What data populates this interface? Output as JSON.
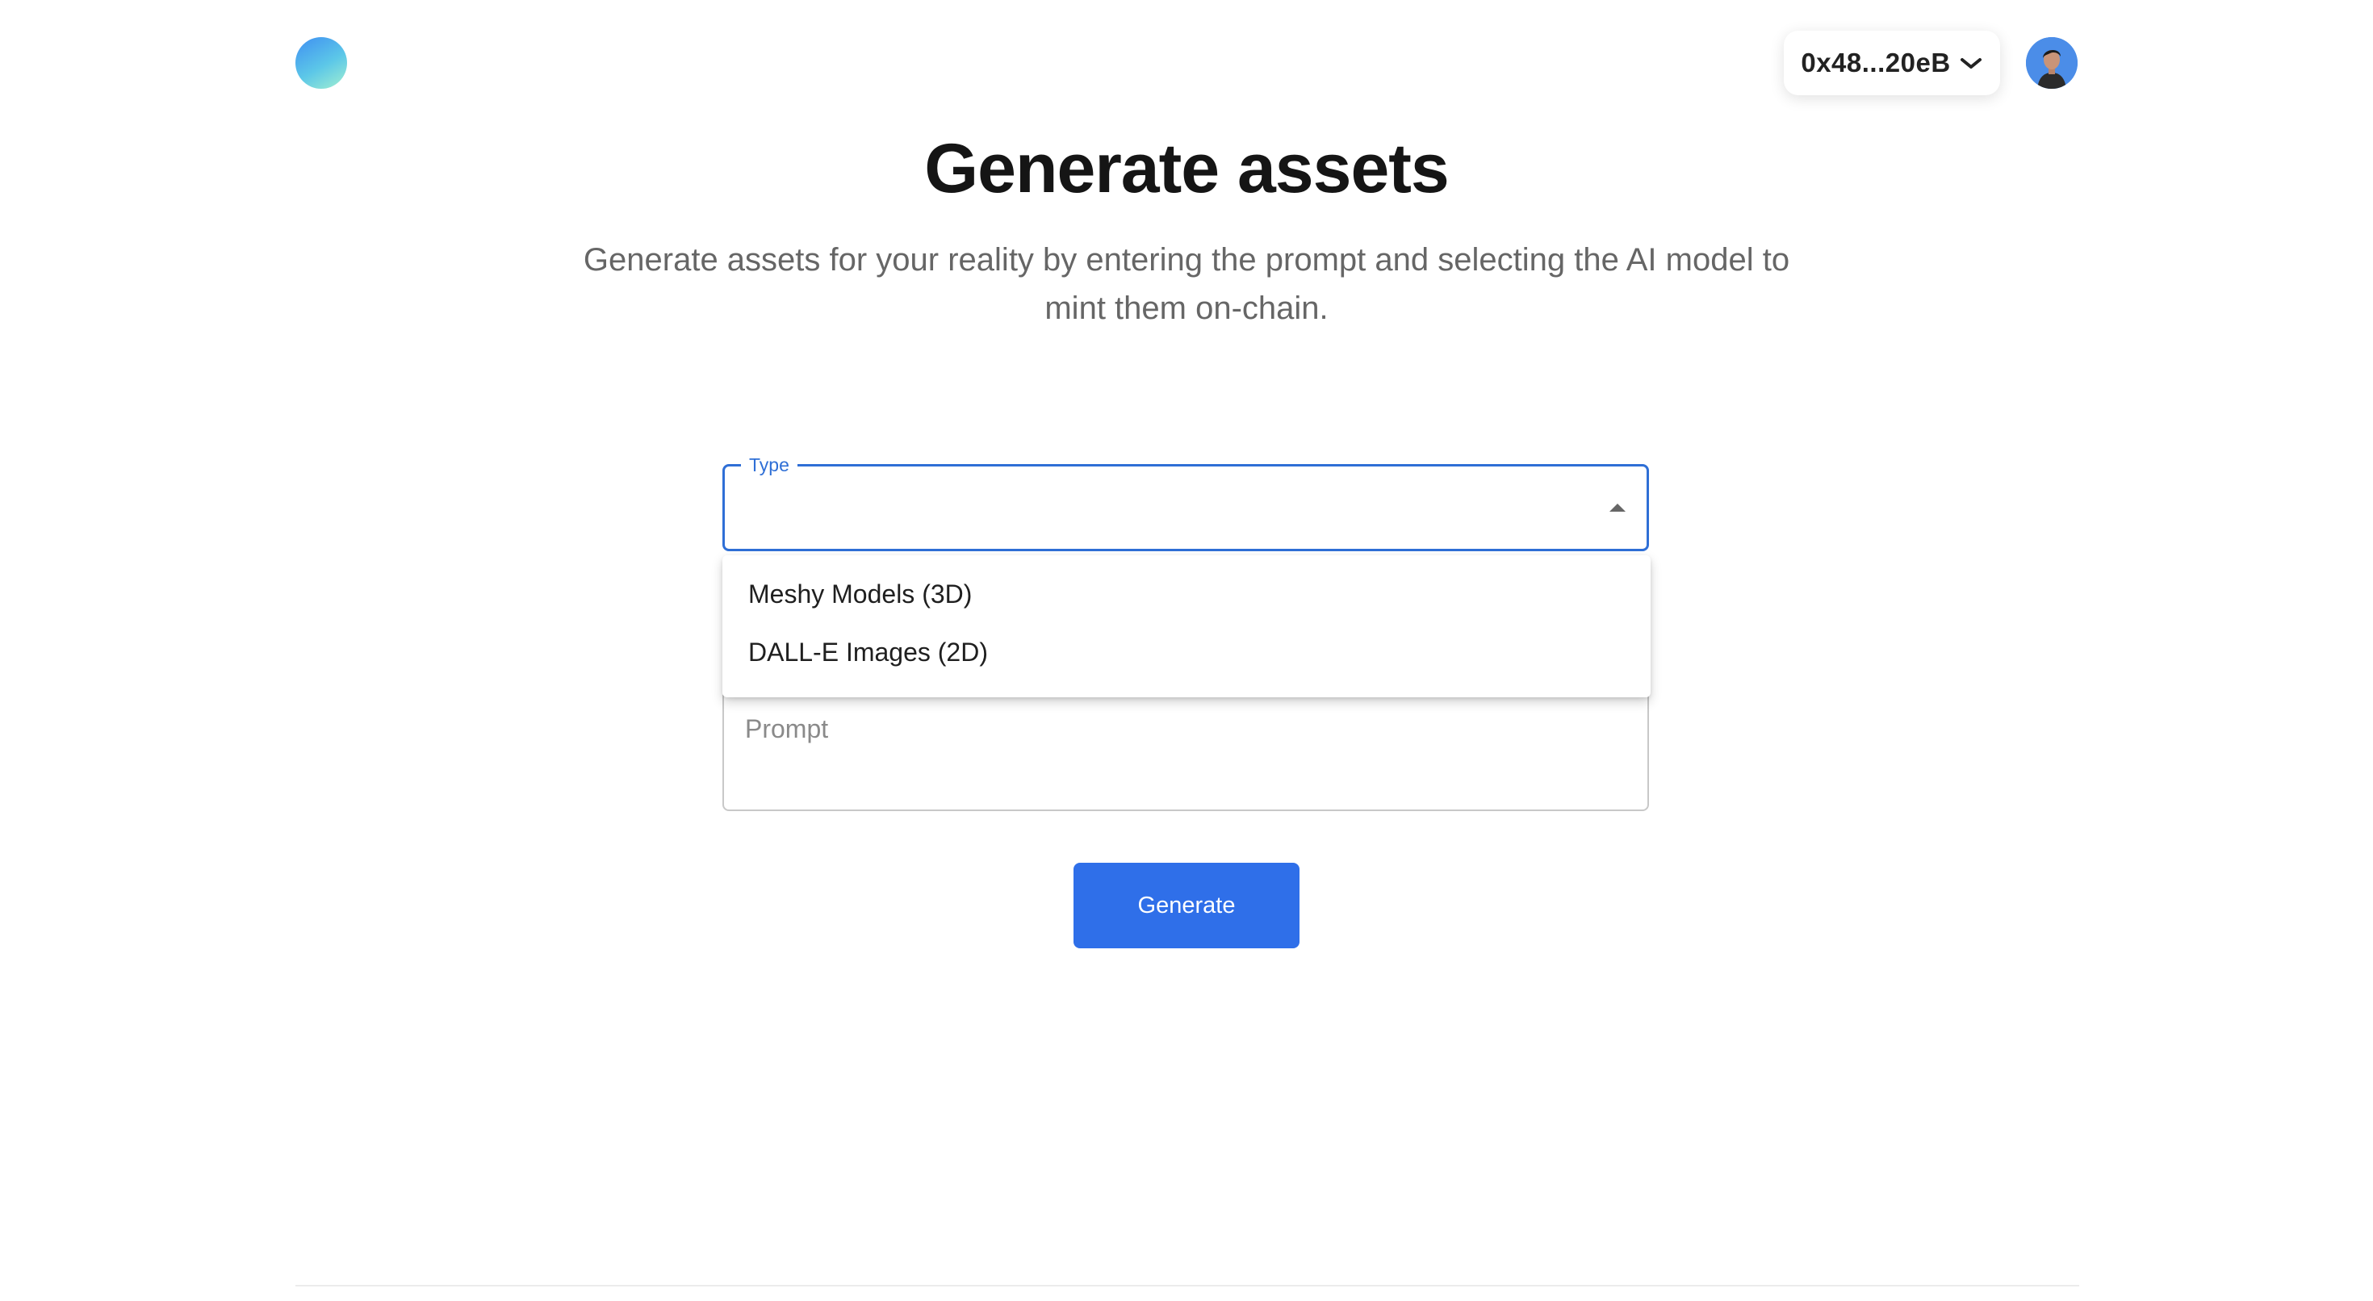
{
  "header": {
    "logo_icon": "gradient-orb-logo",
    "wallet": {
      "address": "0x48...20eB",
      "icon": "chevron-down-icon"
    },
    "avatar_icon": "user-avatar"
  },
  "hero": {
    "title": "Generate assets",
    "subtitle": "Generate assets for your reality by entering the prompt and selecting the AI model to mint them on-chain."
  },
  "form": {
    "type_select": {
      "label": "Type",
      "value": "",
      "options": [
        "Meshy Models (3D)",
        "DALL-E Images (2D)"
      ]
    },
    "prompt": {
      "placeholder": "Prompt",
      "value": ""
    },
    "generate_label": "Generate"
  },
  "colors": {
    "accent": "#2f6fe9",
    "focus_border": "#2f6fd6",
    "title_text": "#151515",
    "subtitle_text": "#666666"
  }
}
